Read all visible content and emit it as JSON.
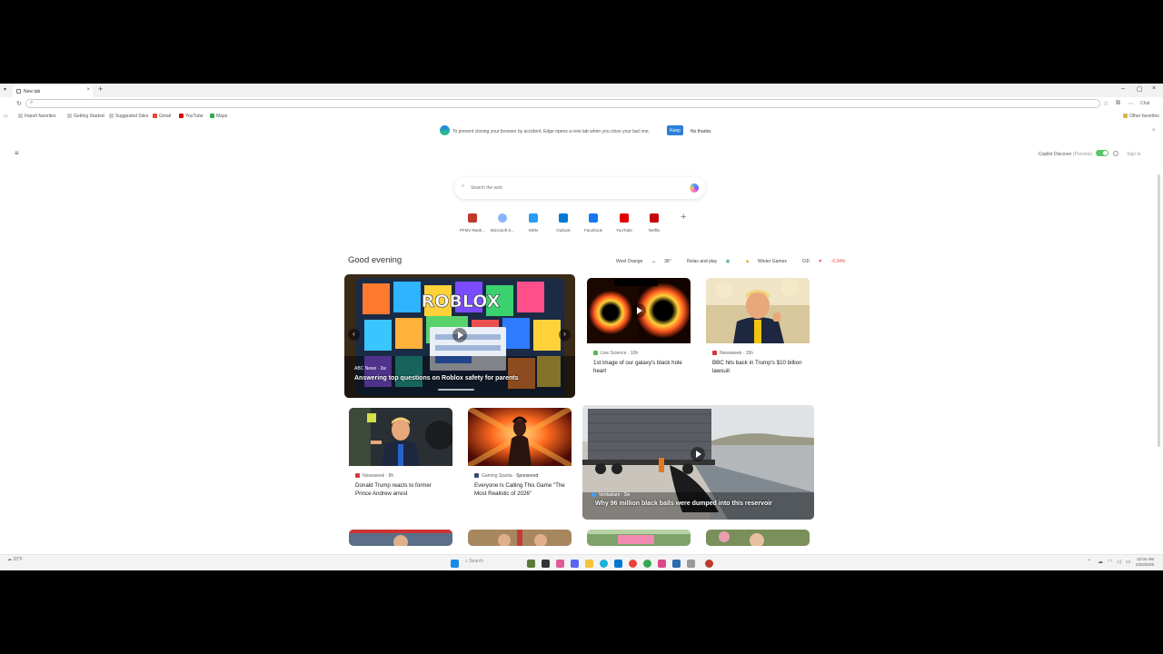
{
  "browser": {
    "tab_title": "New tab",
    "new_tab_symbol": "+",
    "tab_close_symbol": "×",
    "win_min": "–",
    "win_max": "▢",
    "win_close": "×",
    "chat_label": "Chat",
    "omnibox_value": "",
    "omnibox_placeholder": ""
  },
  "favorites": {
    "items": [
      {
        "label": "Import favorites",
        "color": "#9aa0a6"
      },
      {
        "label": "Getting Started",
        "color": "#9aa0a6"
      },
      {
        "label": "Suggested Sites",
        "color": "#9aa0a6"
      },
      {
        "label": "Gmail",
        "color": "#ea4335"
      },
      {
        "label": "YouTube",
        "color": "#e00000"
      },
      {
        "label": "Maps",
        "color": "#34a853"
      }
    ],
    "other": "Other favorites"
  },
  "banner": {
    "text": "To prevent closing your browser by accident, Edge opens a new tab when you close your last one.",
    "keep": "Keep",
    "no_thanks": "No thanks",
    "close": "×"
  },
  "top": {
    "copilot_label": "Copilot Discover",
    "copilot_preview": "(Preview)",
    "sign_in": "Sign in"
  },
  "search": {
    "placeholder": "Search the web",
    "value": ""
  },
  "quick_links": [
    {
      "label": "PFMV Rank...",
      "color": "#c0392b"
    },
    {
      "label": "Microsoft S...",
      "color": "#8ab4f8"
    },
    {
      "label": "MSN",
      "color": "#2a9df4"
    },
    {
      "label": "Outlook",
      "color": "#0078d4"
    },
    {
      "label": "Facebook",
      "color": "#1877f2"
    },
    {
      "label": "YouTube",
      "color": "#e00000"
    },
    {
      "label": "Netflix",
      "color": "#c40812"
    }
  ],
  "feed": {
    "greeting": "Good evening",
    "weather_location": "West Orange",
    "temperature": "36°",
    "relax": "Relax and play",
    "winter_games": "Winter Games",
    "dji": "DJI",
    "dji_change": "-0.34%"
  },
  "cards": {
    "hero": {
      "source": "ABC News · 2w",
      "title": "Answering top questions on Roblox safety for parents"
    },
    "blackhole": {
      "source": "Live Science · 10h",
      "title": "1st image of our galaxy's black hole heart"
    },
    "bbc": {
      "source": "Newsweek · 15h",
      "title": "BBC hits back in Trump's $10 billion lawsuit"
    },
    "andrew": {
      "source": "Newsweek · 8h",
      "title": "Donald Trump reacts to former Prince Andrew arrest"
    },
    "game": {
      "source": "Gaming Sparta",
      "sponsored": "Sponsored",
      "title": "Everyone Is Calling This Game \"The Most Realistic of 2026\""
    },
    "veritasium": {
      "source": "Veritasium · 3w",
      "title": "Why 96 million black balls were dumped into this reservoir"
    }
  },
  "taskbar": {
    "temp": "33°F",
    "search": "Search",
    "time": "12:04 AM",
    "date": "2/20/2026"
  }
}
